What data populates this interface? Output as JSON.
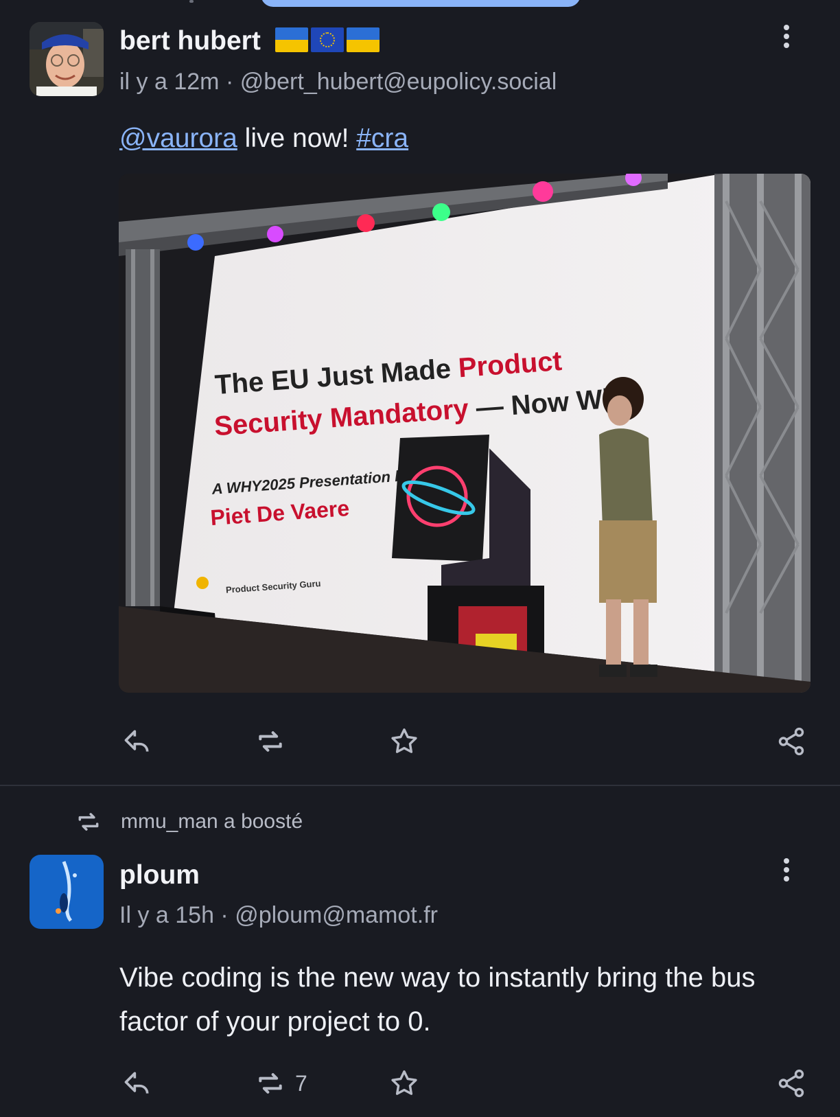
{
  "colors": {
    "background": "#191b22",
    "link": "#8ab4f8",
    "muted": "#a6abb8",
    "text": "#eef0f5"
  },
  "posts": [
    {
      "author": {
        "display_name": "bert hubert",
        "flags": [
          "ukraine-flag",
          "eu-flag",
          "ukraine-flag"
        ]
      },
      "time": "il y a 12m",
      "separator": " · ",
      "handle": "@bert_hubert@eupolicy.social",
      "content": {
        "mention": "@vaurora",
        "text": " live now! ",
        "hashtag": "#cra"
      },
      "image": {
        "slide_title_1": "The EU Just Made ",
        "slide_title_1_red": "Product",
        "slide_title_2_red": "Security Mandatory",
        "slide_title_2": " — Now Wha",
        "slide_sub": "A WHY2025 Presentation by",
        "slide_speaker": "Piet De Vaere",
        "slide_footer": "Product Security Guru"
      },
      "actions": {
        "reply_icon": "reply-icon",
        "boost_icon": "boost-icon",
        "favourite_icon": "star-icon",
        "share_icon": "share-icon",
        "boost_count": ""
      }
    },
    {
      "boosted_by": "mmu_man a boosté",
      "author": {
        "display_name": "ploum"
      },
      "time": "Il y a 15h",
      "separator": " · ",
      "handle": "@ploum@mamot.fr",
      "content": {
        "line1": "Vibe coding is the new way to instantly bring the bus",
        "line2": "factor of your project to 0."
      },
      "actions": {
        "reply_icon": "reply-icon",
        "boost_icon": "boost-icon",
        "favourite_icon": "star-icon",
        "share_icon": "share-icon",
        "boost_count": "7"
      }
    }
  ]
}
